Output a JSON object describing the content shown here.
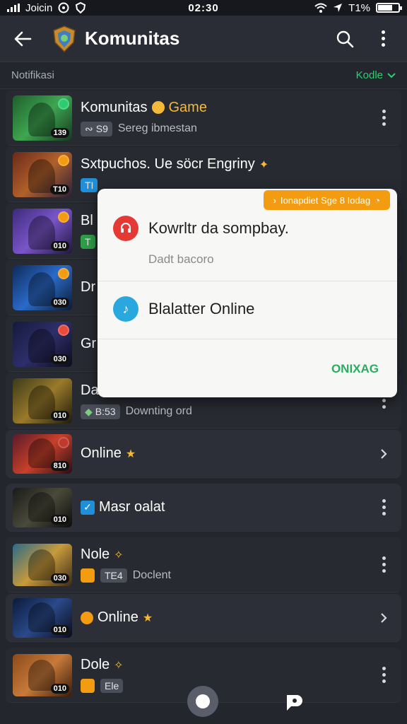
{
  "status": {
    "carrier": "Joicin",
    "time": "02:30",
    "battery": "T1%",
    "battery_level": 0.71
  },
  "app_bar": {
    "title": "Komunitas"
  },
  "section": {
    "label": "Notifikasi",
    "link": "Kodle"
  },
  "rows": [
    {
      "title": "Komunitas",
      "title_accent": "Game",
      "chip": "S9",
      "subtitle": "Sereg ibmestan",
      "tag": "139"
    },
    {
      "title": "Sxtpuchos. Ue söcr Engriny",
      "chip": "TI",
      "subtitle": "",
      "tag": "T10"
    },
    {
      "title": "Bl",
      "chip": "T",
      "subtitle": "",
      "tag": "010"
    },
    {
      "title": "Dr",
      "chip": "",
      "subtitle": "",
      "tag": "030"
    },
    {
      "title": "Gr",
      "chip": "",
      "subtitle": "",
      "tag": "030"
    },
    {
      "title": "Dabs",
      "chip": "B:53",
      "subtitle": "Downting ord",
      "tag": "010"
    },
    {
      "title": "Online",
      "tag": "810"
    },
    {
      "title": "Masr oalat",
      "tag": "010"
    },
    {
      "title": "Nole",
      "chip": "TE4",
      "subtitle": "Doclent",
      "tag": "030"
    },
    {
      "title": "Online",
      "tag": "010"
    },
    {
      "title": "Dole",
      "chip": "Ele",
      "tag": "010"
    }
  ],
  "popup": {
    "toast": "Ionapdiet Sge 8 Iodag",
    "item1": "Kowrltr da sompbay.",
    "item1_sub": "Dadt bacoro",
    "item2": "Blalatter Online",
    "action": "ONIXAG"
  },
  "colors": {
    "accent_green": "#2ecc71",
    "accent_orange": "#f39c12",
    "accent_blue": "#1e8fd8",
    "background": "#23262d"
  }
}
